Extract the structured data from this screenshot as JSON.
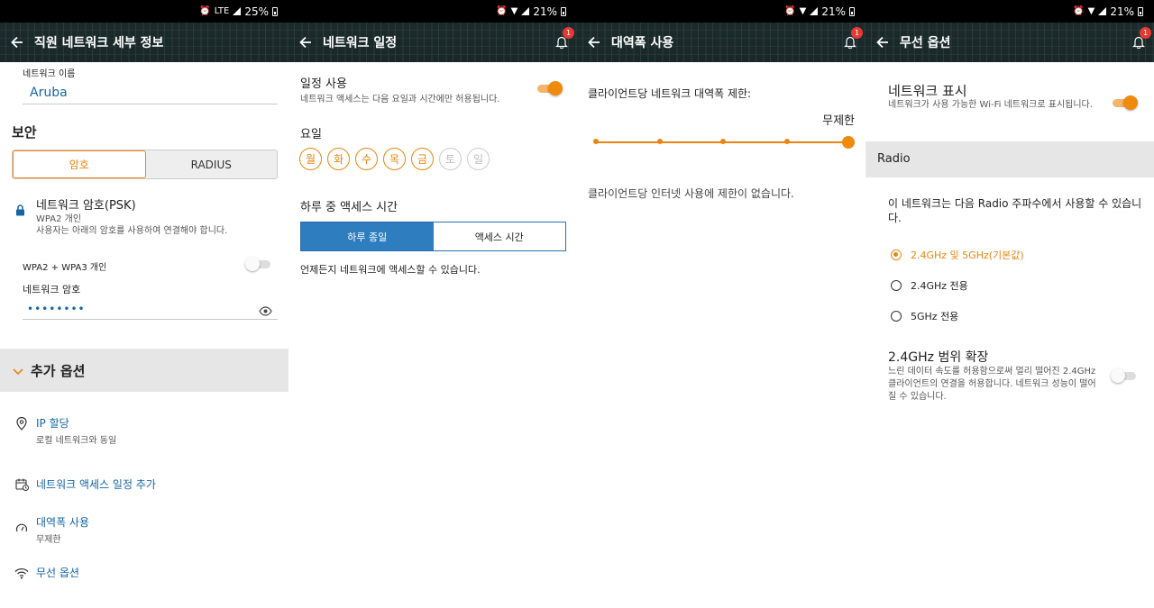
{
  "status_bars": [
    {
      "battery": "25%",
      "network": "LTE"
    },
    {
      "battery": "21%"
    },
    {
      "battery": "21%"
    },
    {
      "battery": "21%"
    }
  ],
  "notification_count": "1",
  "screen1": {
    "title": "직원 네트워크 세부 정보",
    "network_name_label": "네트워크 이름",
    "network_name_value": "Aruba",
    "security_heading": "보안",
    "seg_password": "암호",
    "seg_radius": "RADIUS",
    "psk_title": "네트워크 암호(PSK)",
    "psk_sub1": "WPA2 개인",
    "psk_sub2": "사용자는 아래의 암호를 사용하여 연결해야 합니다.",
    "wpa3_label": "WPA2 + WPA3 개인",
    "password_label": "네트워크 암호",
    "password_value": "••••••••",
    "more_options": "추가 옵션",
    "ip_title": "IP 할당",
    "ip_sub": "로컬 네트워크와 동일",
    "schedule_title": "네트워크 액세스 일정 추가",
    "bandwidth_title": "대역폭 사용",
    "bandwidth_sub": "무제한",
    "wireless_title": "무선 옵션"
  },
  "screen2": {
    "title": "네트워크 일정",
    "use_schedule_title": "일정 사용",
    "use_schedule_sub": "네트워크 액세스는 다음 요일과 시간에만 허용됩니다.",
    "days_label": "요일",
    "days": [
      "월",
      "화",
      "수",
      "목",
      "금",
      "토",
      "일"
    ],
    "time_heading": "하루 중 액세스 시간",
    "seg_all_day": "하루 종일",
    "seg_access_time": "액세스 시간",
    "footer": "언제든지 네트워크에 액세스할 수 있습니다."
  },
  "screen3": {
    "title": "대역폭 사용",
    "limit_label": "클라이언트당 네트워크 대역폭 제한:",
    "value_label": "무제한",
    "desc": "클라이언트당 인터넷 사용에 제한이 없습니다."
  },
  "screen4": {
    "title": "무선 옵션",
    "show_network_title": "네트워크 표시",
    "show_network_sub": "네트워크가 사용 가능한 Wi-Fi 네트워크로 표시됩니다.",
    "radio_heading": "Radio",
    "radio_desc": "이 네트워크는 다음 Radio 주파수에서 사용할 수 있습니다.",
    "option1": "2.4GHz 및 5GHz(기본값)",
    "option2": "2.4GHz 전용",
    "option3": "5GHz 전용",
    "range_title": "2.4GHz 범위 확장",
    "range_sub": "느린 데이터 속도를 허용함으로써 멀리 떨어진 2.4GHz 클라이언트의 연결을 허용합니다. 네트워크 성능이 떨어질 수 있습니다."
  },
  "colors": {
    "accent": "#e8860f",
    "link": "#1565a5",
    "segment_blue": "#2e7dbf"
  }
}
